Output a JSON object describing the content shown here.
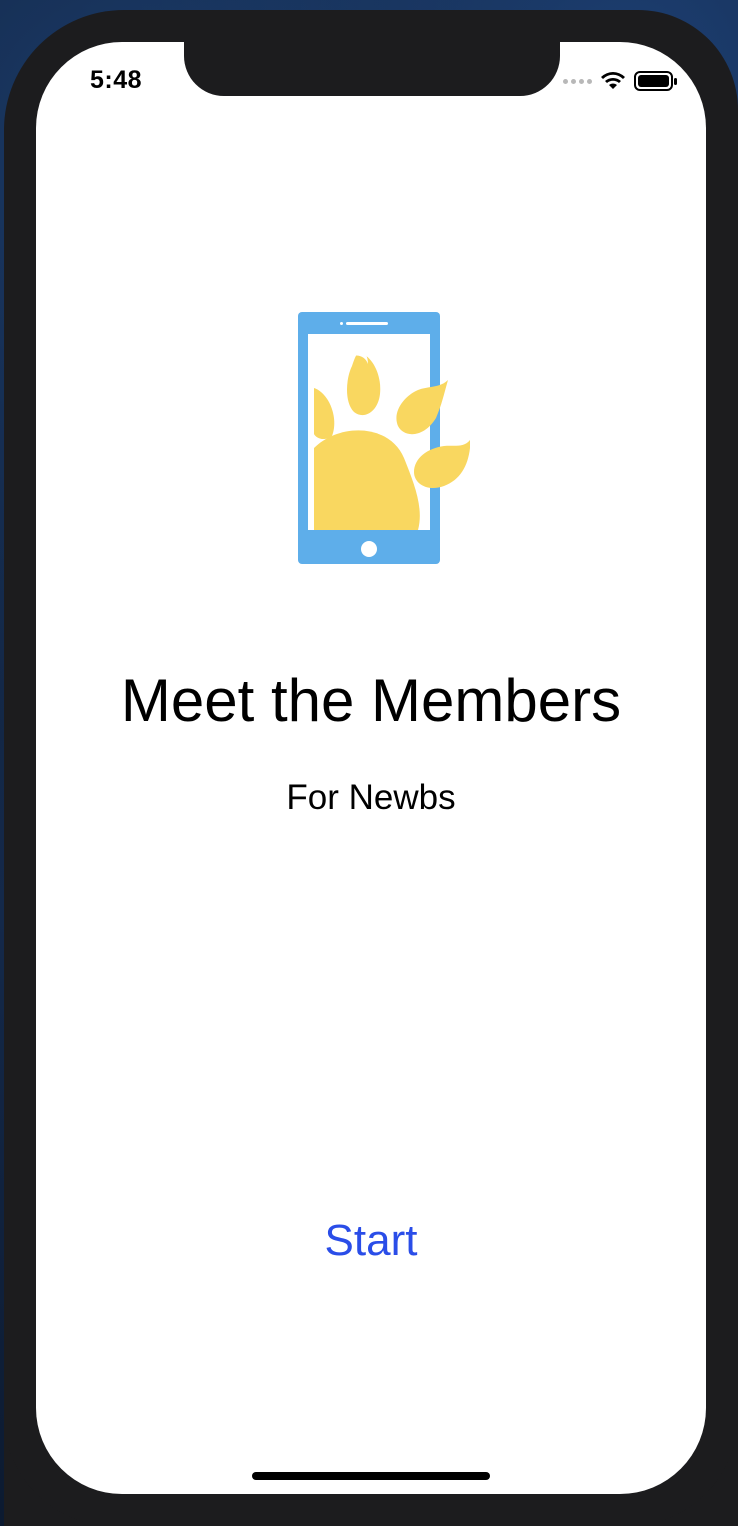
{
  "status_bar": {
    "time": "5:48"
  },
  "app": {
    "title": "Meet the Members",
    "subtitle": "For Newbs",
    "start_label": "Start"
  },
  "colors": {
    "accent": "#2a4de8",
    "icon_phone": "#5eaeea",
    "icon_paw": "#f9d760"
  },
  "icons": {
    "app_logo": "phone-with-paw-icon",
    "wifi": "wifi-icon",
    "battery": "battery-icon",
    "signal": "signal-dots-icon"
  }
}
